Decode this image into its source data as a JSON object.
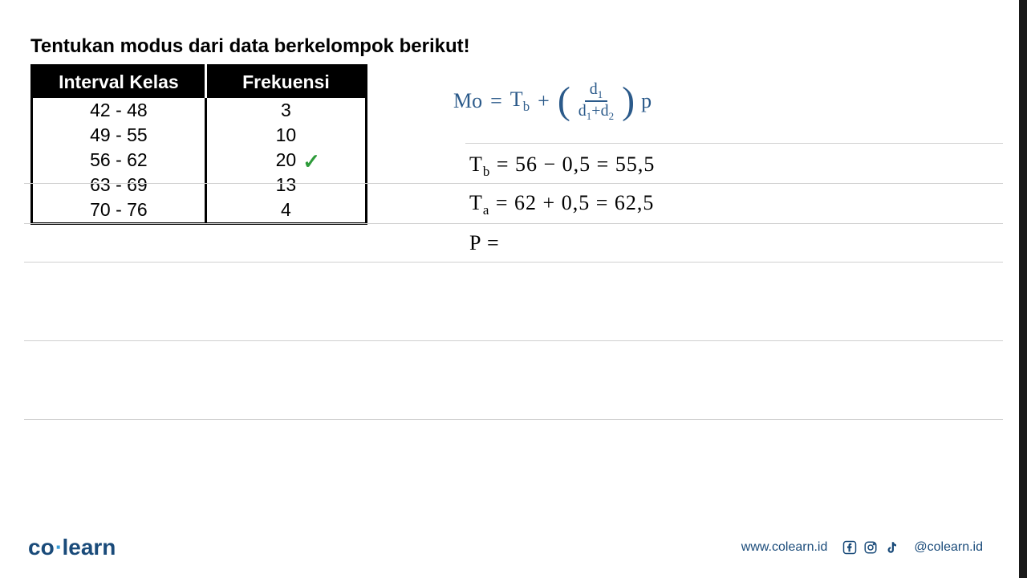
{
  "question": "Tentukan modus dari data berkelompok berikut!",
  "table": {
    "headers": [
      "Interval Kelas",
      "Frekuensi"
    ],
    "rows": [
      {
        "interval": "42 - 48",
        "freq": "3",
        "checked": false
      },
      {
        "interval": "49 - 55",
        "freq": "10",
        "checked": false
      },
      {
        "interval": "56 - 62",
        "freq": "20",
        "checked": true
      },
      {
        "interval": "63 - 69",
        "freq": "13",
        "checked": false
      },
      {
        "interval": "70 - 76",
        "freq": "4",
        "checked": false
      }
    ]
  },
  "formula": {
    "lhs": "Mo",
    "eq": "=",
    "tb": "T",
    "tb_sub": "b",
    "plus": "+",
    "d1": "d",
    "d1_sub": "1",
    "d2": "d",
    "d2_sub": "2",
    "p": "p"
  },
  "work": {
    "tb_line": "T",
    "tb_sub": "b",
    "tb_rest": " = 56 − 0,5 = 55,5",
    "ta_line": "T",
    "ta_sub": "a",
    "ta_rest": " = 62 + 0,5 = 62,5",
    "p_line": "P =",
    "p_rest": ""
  },
  "footer": {
    "logo_co": "co",
    "logo_learn": "learn",
    "url": "www.colearn.id",
    "handle": "@colearn.id"
  },
  "chart_data": {
    "type": "table",
    "title": "Frequency distribution",
    "categories": [
      "42 - 48",
      "49 - 55",
      "56 - 62",
      "63 - 69",
      "70 - 76"
    ],
    "values": [
      3,
      10,
      20,
      13,
      4
    ]
  }
}
